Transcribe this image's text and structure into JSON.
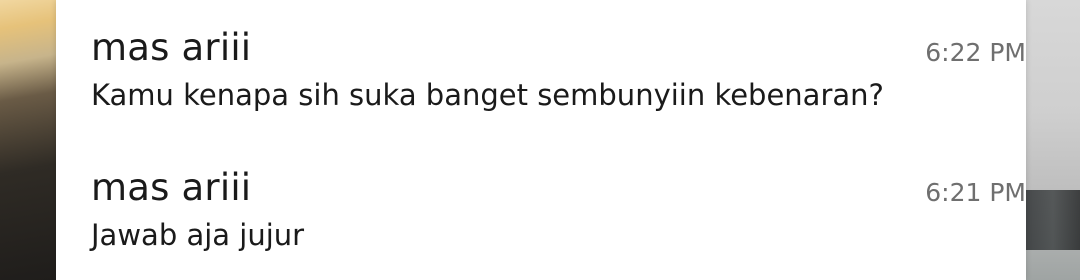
{
  "notifications": [
    {
      "sender": "mas ariii",
      "message": "Kamu kenapa sih suka banget sembunyiin kebenaran?",
      "time": "6:22 PM"
    },
    {
      "sender": "mas ariii",
      "message": "Jawab aja jujur",
      "time": "6:21 PM"
    }
  ]
}
